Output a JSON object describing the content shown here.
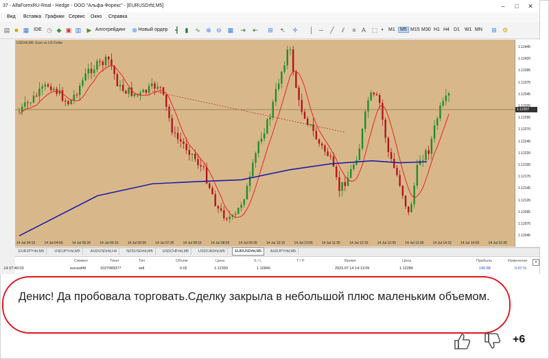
{
  "window": {
    "title": "37 - AlfaForexRU-Real - Hedge - ООО \"Альфа-Форекс\" - [EURUSDrfd,M5]",
    "minimize": "–",
    "maximize": "□",
    "close": "✕"
  },
  "menu": [
    "Вид",
    "Вставка",
    "Графики",
    "Сервис",
    "Окно",
    "Справка"
  ],
  "toolbar": {
    "ide": "IDE",
    "algo": "Алготрейдинг",
    "new_order": "Новый ордер",
    "timeframes": [
      "M1",
      "M5",
      "M15",
      "M30",
      "H1",
      "H4",
      "D1",
      "W1",
      "MN"
    ],
    "active_timeframe": "M5"
  },
  "chart": {
    "label": "USDrfd,M5: Euro vs US Dollar",
    "current_price": "1.12307",
    "price_ticks": [
      "1.12445",
      "1.12420",
      "1.12395",
      "1.12370",
      "1.12345",
      "1.12320",
      "1.12295",
      "1.12270",
      "1.12245",
      "1.12220",
      "1.12195",
      "1.12170",
      "1.12145",
      "1.12120",
      "1.12095",
      "1.12070",
      "1.12045"
    ],
    "time_ticks": [
      "14 Jul 04:15",
      "14 Jul 04:55",
      "14 Jul 05:35",
      "14 Jul 06:15",
      "14 Jul 06:55",
      "14 Jul 07:35",
      "14 Jul 08:15",
      "14 Jul 08:55",
      "14 Jul 09:35",
      "14 Jul 10:15",
      "14 Jul 10:55",
      "14 Jul 11:35",
      "14 Jul 12:15",
      "14 Jul 12:55",
      "14 Jul 13:35",
      "14 Jul 14:15",
      "14 Jul 14:55",
      "14 Jul 15:35"
    ],
    "bg_color": "#d8b88a",
    "bull_color": "#1f8c2a",
    "bear_color": "#b3131b",
    "ma_fast_color": "#e8231c",
    "ma_slow_color": "#1c1ca8"
  },
  "chart_tabs": [
    "EURJPYrfd,M5",
    "USDJPYrfd,M5",
    "AUDUSDrfd,H4",
    "NZDUSDrfd,M5",
    "USDCHFrfd,M5",
    "USDCADrfd,M5",
    "EURUSDrfd,M5",
    "AUDJPYrfd,M5"
  ],
  "active_chart_tab": "EURUSDrfd,M5",
  "terminal": {
    "headers": [
      "Символ",
      "Тикет",
      "Тип",
      "Объём",
      "Цена",
      "S / L",
      "T / P",
      "Время",
      "Цена",
      "Прибыль",
      "Изменение"
    ],
    "row": {
      "time_left": ".14 07:40:03",
      "symbol": "eurusdrfd",
      "ticket": "1027089377",
      "type": "sell",
      "volume": "0.02",
      "price": "1.12330",
      "sl": "1.12846",
      "tp": "",
      "time": "2023.07.14 14:13:05",
      "price_now": "1.12286",
      "profit": "140.88",
      "change": "0.07 %"
    }
  },
  "comment": {
    "text": "Денис! Да пробовала торговать.Сделку закрыла в небольшой плюс маленьким объемом."
  },
  "votes": {
    "score": "+6"
  }
}
